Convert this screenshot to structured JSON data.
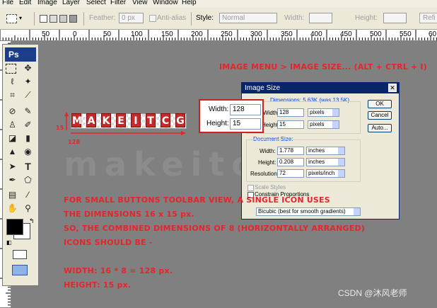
{
  "menu": [
    "File",
    "Edit",
    "Image",
    "Layer",
    "Select",
    "Filter",
    "View",
    "Window",
    "Help"
  ],
  "options": {
    "feather_label": "Feather:",
    "feather_value": "0 px",
    "antialias_label": "Anti-alias",
    "style_label": "Style:",
    "style_value": "Normal",
    "width_label": "Width:",
    "height_label": "Height:",
    "refine_label": "Refi"
  },
  "ruler_h": [
    "50",
    "0",
    "50",
    "100",
    "150",
    "200",
    "250",
    "300",
    "350",
    "400",
    "450",
    "500",
    "550",
    "60"
  ],
  "toolbox": {
    "logo": "Ps",
    "type_tool": "T"
  },
  "logo_letters": [
    "M",
    "A",
    "K",
    "E",
    "I",
    "T",
    "C",
    "G"
  ],
  "logo_dims": {
    "height": "15",
    "width": "128"
  },
  "heading": "IMAGE MENU > IMAGE SIZE... (ALT + CTRL + I)",
  "callout": {
    "width_label": "Width:",
    "width_value": "128",
    "height_label": "Height:",
    "height_value": "15"
  },
  "dialog": {
    "title": "Image Size",
    "pixel_dims": "Dimensions: 5.63K (was 13.5K)",
    "width_label": "Width:",
    "width_value": "128",
    "height_label": "Height:",
    "height_value": "15",
    "pixels": "pixels",
    "doc_size": "Document Size:",
    "doc_width_value": "1.778",
    "doc_height_value": "0.208",
    "inches": "inches",
    "resolution_label": "Resolution:",
    "resolution_value": "72",
    "ppi": "pixels/inch",
    "scale_styles": "Scale Styles",
    "constrain": "Constrain Proportions",
    "resample": "Bicubic (best for smooth gradients)",
    "ok": "OK",
    "cancel": "Cancel",
    "auto": "Auto..."
  },
  "note_lines": [
    "FOR SMALL BUTTONS TOOLBAR VIEW, A SINGLE ICON USES",
    "THE DIMENSIONS 16 x 15 px.",
    "SO, THE COMBINED DIMENSIONS OF 8 (HORIZONTALLY ARRANGED)",
    "ICONS SHOULD BE -"
  ],
  "calc_width": "WIDTH: 16 * 8 = 128 px.",
  "calc_height": "HEIGHT: 15 px.",
  "watermark": "CSDN @沐风老师"
}
